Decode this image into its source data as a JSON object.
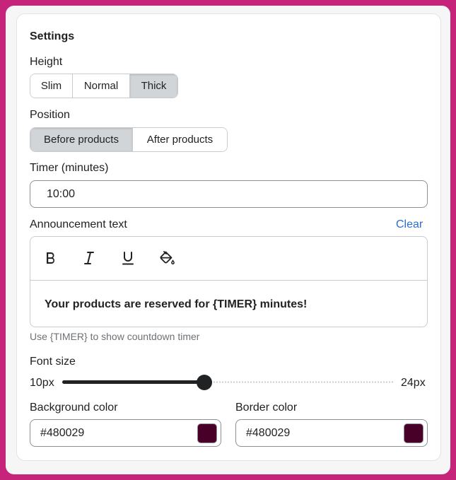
{
  "settings": {
    "title": "Settings",
    "height": {
      "label": "Height",
      "options": [
        "Slim",
        "Normal",
        "Thick"
      ],
      "selected": "Thick"
    },
    "position": {
      "label": "Position",
      "options": [
        "Before products",
        "After products"
      ],
      "selected": "Before products"
    },
    "timer": {
      "label": "Timer (minutes)",
      "value": "10:00"
    },
    "announcement": {
      "label": "Announcement text",
      "clear_label": "Clear",
      "text": "Your products are reserved for {TIMER} minutes!",
      "toolbar": [
        "bold-icon",
        "italic-icon",
        "underline-icon",
        "paint-bucket-icon"
      ],
      "help": "Use {TIMER} to show countdown timer"
    },
    "font_size": {
      "label": "Font size",
      "min_label": "10px",
      "max_label": "24px",
      "min": 10,
      "max": 24,
      "value": 16
    },
    "background_color": {
      "label": "Background color",
      "value": "#480029",
      "swatch": "#480029"
    },
    "border_color": {
      "label": "Border color",
      "value": "#480029",
      "swatch": "#480029"
    }
  }
}
